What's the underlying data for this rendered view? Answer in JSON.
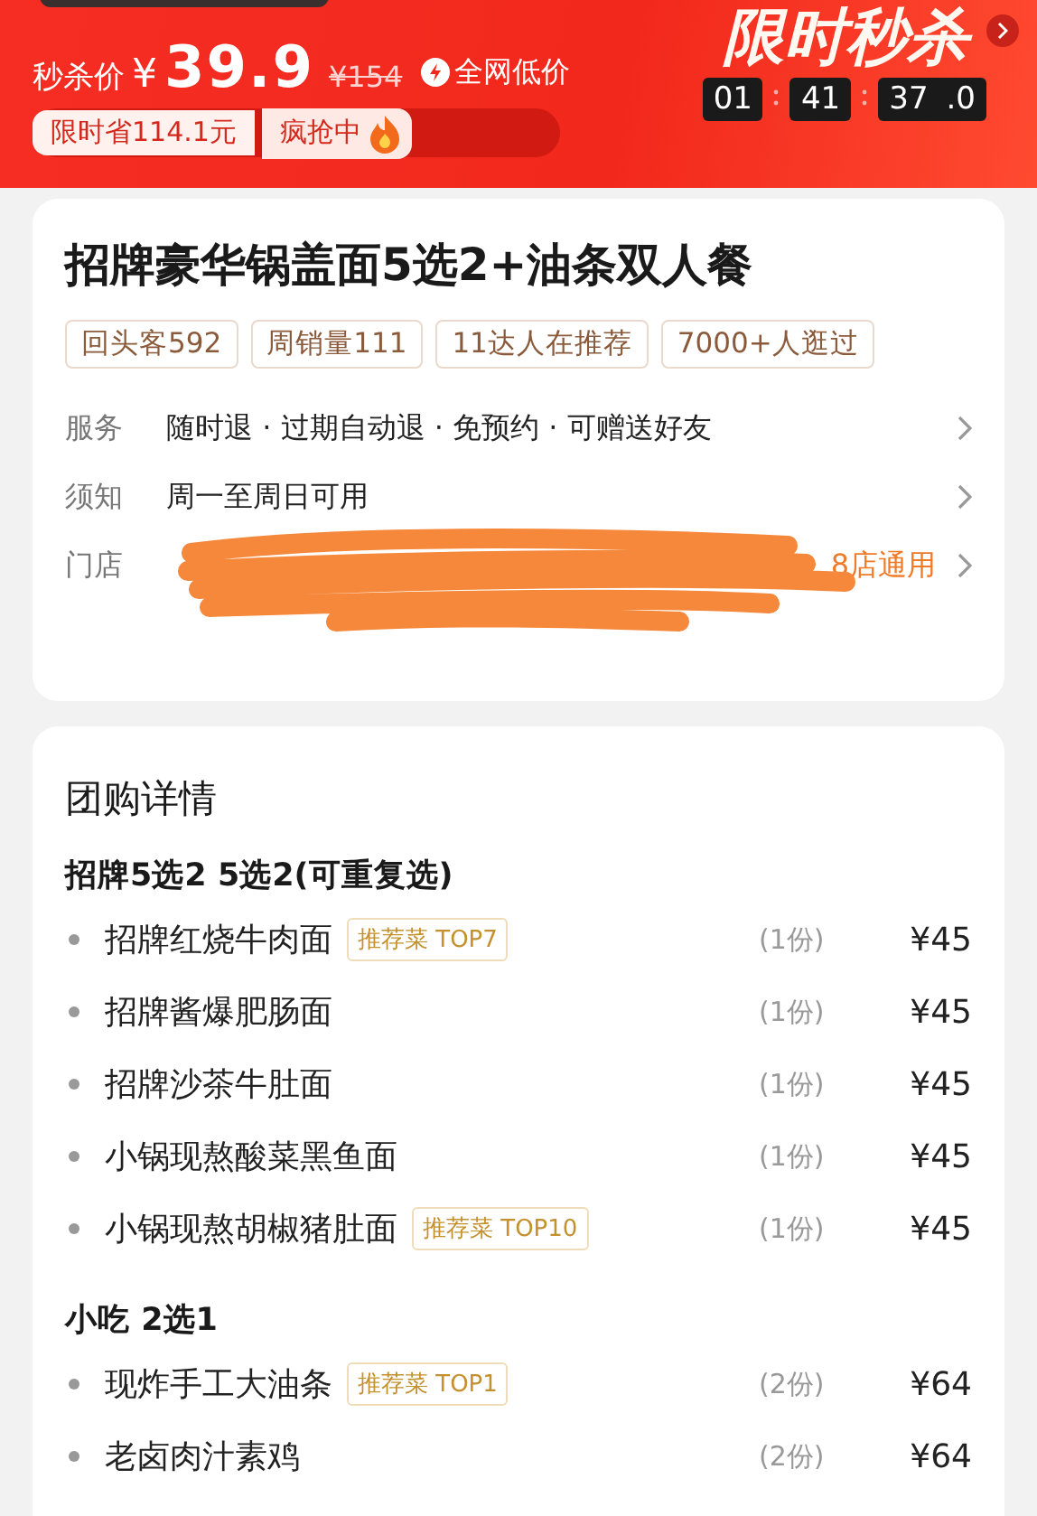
{
  "flash_sale": {
    "title": "限时秒杀",
    "price_label": "秒杀价",
    "currency": "¥",
    "price": "39.9",
    "original_price": "¥154",
    "lowest_badge": "全网低价",
    "saving": "限时省114.1元",
    "status": "疯抢中",
    "countdown": [
      "01",
      "41",
      "37"
    ],
    "countdown_tenths": ".0"
  },
  "deal": {
    "title": "招牌豪华锅盖面5选2+油条双人餐",
    "tags": [
      "回头客592",
      "周销量111",
      "11达人在推荐",
      "7000+人逛过"
    ],
    "info_rows": [
      {
        "label": "服务",
        "value": "随时退 · 过期自动退 · 免预约 · 可赠送好友",
        "kind": "text"
      },
      {
        "label": "须知",
        "value": "周一至周日可用",
        "kind": "text"
      },
      {
        "label": "门店",
        "value": "8店通用",
        "kind": "redacted"
      }
    ]
  },
  "details": {
    "title": "团购详情",
    "groups": [
      {
        "title": "招牌5选2 5选2(可重复选)",
        "items": [
          {
            "name": "招牌红烧牛肉面",
            "badge": "推荐菜 TOP7",
            "qty": "(1份)",
            "price": "¥45"
          },
          {
            "name": "招牌酱爆肥肠面",
            "qty": "(1份)",
            "price": "¥45"
          },
          {
            "name": "招牌沙茶牛肚面",
            "qty": "(1份)",
            "price": "¥45"
          },
          {
            "name": "小锅现熬酸菜黑鱼面",
            "qty": "(1份)",
            "price": "¥45"
          },
          {
            "name": "小锅现熬胡椒猪肚面",
            "badge": "推荐菜 TOP10",
            "qty": "(1份)",
            "price": "¥45"
          }
        ]
      },
      {
        "title": "小吃 2选1",
        "items": [
          {
            "name": "现炸手工大油条",
            "badge": "推荐菜 TOP1",
            "qty": "(2份)",
            "price": "¥64"
          },
          {
            "name": "老卤肉汁素鸡",
            "qty": "(2份)",
            "price": "¥64"
          }
        ]
      }
    ]
  }
}
